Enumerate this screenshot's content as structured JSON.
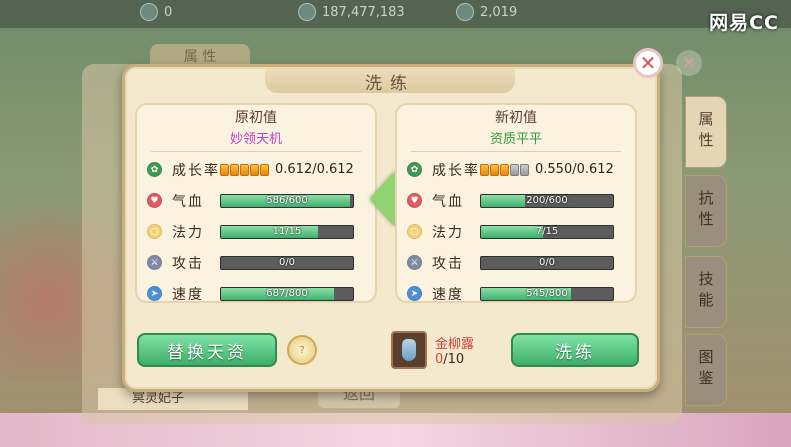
{
  "top_bar": {
    "stat1": "0",
    "stat2": "187,477,183",
    "stat3": "2,019"
  },
  "brand": "网易CC",
  "background": {
    "tab_attr": "属 性",
    "pet_name": "冥灵妃子",
    "back_button": "返回"
  },
  "side_tabs": [
    {
      "label": "属性"
    },
    {
      "label": "抗性"
    },
    {
      "label": "技能"
    },
    {
      "label": "图鉴"
    }
  ],
  "dialog": {
    "title": "洗练",
    "close_icon": "close-icon",
    "original": {
      "heading": "原初值",
      "quality": "妙领天机",
      "quality_color": "#c03ec9",
      "growth_text": "0.612/0.612",
      "growth_pills": {
        "on": 5,
        "total": 5
      },
      "stats": [
        {
          "label": "气血",
          "text": "586/600",
          "fill": 0.977
        },
        {
          "label": "法力",
          "text": "11/15",
          "fill": 0.733
        },
        {
          "label": "攻击",
          "text": "0/0",
          "fill": 0
        },
        {
          "label": "速度",
          "text": "687/800",
          "fill": 0.859
        }
      ]
    },
    "new": {
      "heading": "新初值",
      "quality": "资质平平",
      "quality_color": "#2f9a3f",
      "growth_text": "0.550/0.612",
      "growth_pills": {
        "on": 3,
        "total": 5
      },
      "stats": [
        {
          "label": "气血",
          "text": "200/600",
          "fill": 0.333
        },
        {
          "label": "法力",
          "text": "7/15",
          "fill": 0.467
        },
        {
          "label": "攻击",
          "text": "0/0",
          "fill": 0
        },
        {
          "label": "速度",
          "text": "545/800",
          "fill": 0.681
        }
      ]
    },
    "growth_label": "成长率",
    "replace_button": "替换天资",
    "refine_button": "洗练",
    "item": {
      "name": "金柳露",
      "current": "0",
      "total": "/10"
    },
    "colors": {
      "accent_green": "#3fae6a",
      "arrow_green": "#8fd46f"
    }
  }
}
